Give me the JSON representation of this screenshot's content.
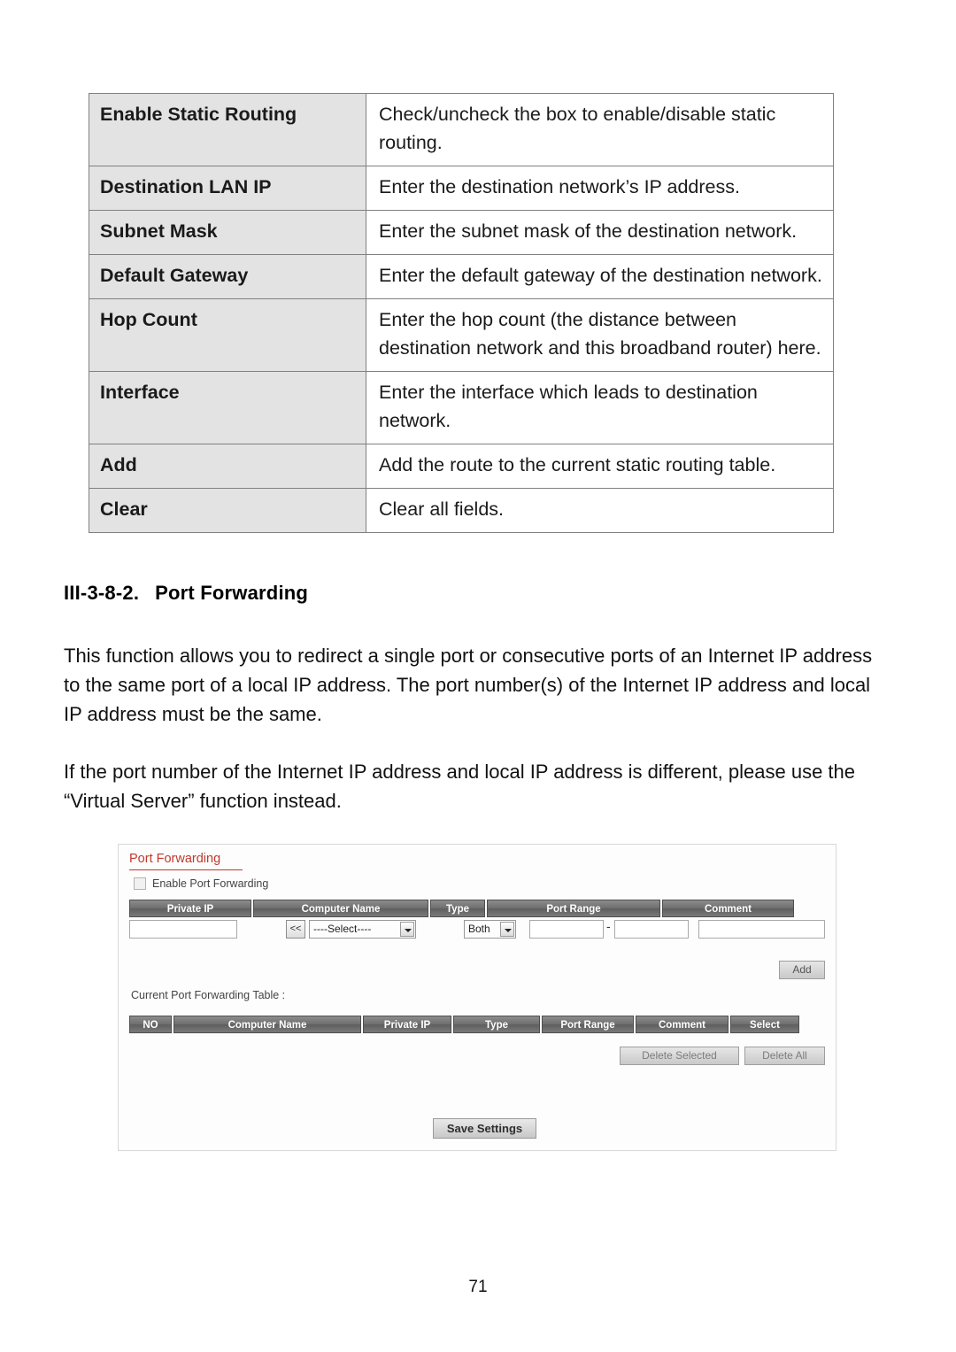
{
  "definition_table": {
    "rows": [
      {
        "term": "Enable Static Routing",
        "desc": "Check/uncheck the box to enable/disable static routing."
      },
      {
        "term": "Destination LAN IP",
        "desc": "Enter the destination network’s IP address."
      },
      {
        "term": "Subnet Mask",
        "desc": "Enter the subnet mask of the destination network."
      },
      {
        "term": "Default Gateway",
        "desc": "Enter the default gateway of the destination network."
      },
      {
        "term": "Hop Count",
        "desc": "Enter the hop count (the distance between destination network and this broadband router) here."
      },
      {
        "term": "Interface",
        "desc": "Enter the interface which leads to destination network."
      },
      {
        "term": "Add",
        "desc": "Add the route to the current static routing table."
      },
      {
        "term": "Clear",
        "desc": "Clear all fields."
      }
    ]
  },
  "section": {
    "number": "III-3-8-2.",
    "title": "Port Forwarding",
    "paragraph1": "This function allows you to redirect a single port or consecutive ports of an Internet IP address to the same port of a local IP address. The port number(s) of the Internet IP address and local IP address must be the same.",
    "paragraph2": "If the port number of the Internet IP address and local IP address is different, please use the “Virtual Server” function instead."
  },
  "screenshot": {
    "title": "Port Forwarding",
    "enable_checkbox_label": "Enable  Port Forwarding",
    "entry_headers": [
      "Private IP",
      "Computer Name",
      "Type",
      "Port Range",
      "Comment"
    ],
    "entry_row": {
      "private_ip_value": "",
      "copy_button_label": "<<",
      "computer_name_select": "----Select----",
      "type_select": "Both",
      "port_range_start": "",
      "port_range_separator": "-",
      "port_range_end": "",
      "comment_value": ""
    },
    "add_button_label": "Add",
    "current_table_label": "Current Port Forwarding Table :",
    "table_headers": [
      "NO",
      "Computer Name",
      "Private IP",
      "Type",
      "Port Range",
      "Comment",
      "Select"
    ],
    "delete_selected_label": "Delete Selected",
    "delete_all_label": "Delete All",
    "save_button_label": "Save Settings",
    "accent_color": "#c0392b"
  },
  "footer": {
    "page_number": "71"
  }
}
